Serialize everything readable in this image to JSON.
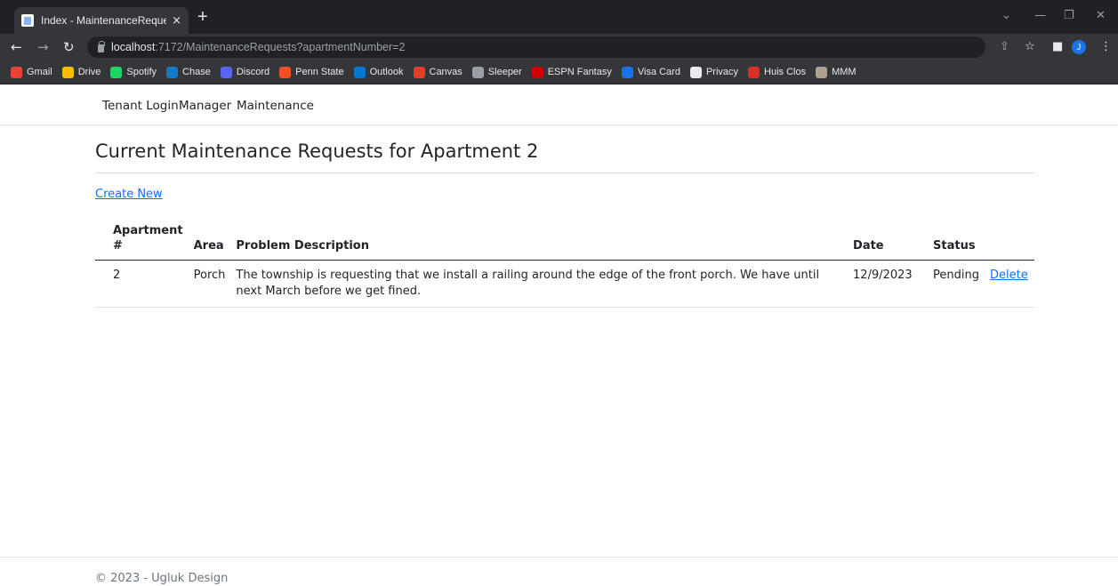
{
  "browser": {
    "tab_title": "Index - MaintenanceRequestApp",
    "tab_close": "×",
    "new_tab": "+",
    "url_host": "localhost",
    "url_rest": ":7172/MaintenanceRequests?apartmentNumber=2",
    "profile_initial": "J",
    "bookmarks": [
      {
        "label": "Gmail",
        "icon": "gmail-icon",
        "color": "#ea4335"
      },
      {
        "label": "Drive",
        "icon": "drive-icon",
        "color": "#fbbc04"
      },
      {
        "label": "Spotify",
        "icon": "spotify-icon",
        "color": "#1ed760"
      },
      {
        "label": "Chase",
        "icon": "chase-icon",
        "color": "#117aca"
      },
      {
        "label": "Discord",
        "icon": "discord-icon",
        "color": "#5865f2"
      },
      {
        "label": "Penn State",
        "icon": "windows-icon",
        "color": "#f25022"
      },
      {
        "label": "Outlook",
        "icon": "outlook-icon",
        "color": "#0078d4"
      },
      {
        "label": "Canvas",
        "icon": "canvas-icon",
        "color": "#e13f2b"
      },
      {
        "label": "Sleeper",
        "icon": "sleeper-icon",
        "color": "#9aa0a6"
      },
      {
        "label": "ESPN Fantasy",
        "icon": "espn-icon",
        "color": "#d00000"
      },
      {
        "label": "Visa Card",
        "icon": "visa-icon",
        "color": "#1a73e8"
      },
      {
        "label": "Privacy",
        "icon": "privacy-icon",
        "color": "#e8eaed"
      },
      {
        "label": "Huis Clos",
        "icon": "huis-clos-icon",
        "color": "#d93025"
      },
      {
        "label": "MMM",
        "icon": "mmm-icon",
        "color": "#b0a090"
      }
    ]
  },
  "nav": {
    "tenant_login": "Tenant Login",
    "manager": "Manager",
    "maintenance": "Maintenance"
  },
  "main": {
    "heading": "Current Maintenance Requests for Apartment 2",
    "create_new": "Create New",
    "columns": {
      "apartment": "Apartment #",
      "area": "Area",
      "problem": "Problem Description",
      "date": "Date",
      "status": "Status"
    },
    "rows": [
      {
        "apartment": "2",
        "area": "Porch",
        "problem": "The township is requesting that we install a railing around the edge of the front porch. We have until next March before we get fined.",
        "date": "12/9/2023",
        "status": "Pending",
        "action": "Delete"
      }
    ]
  },
  "footer": {
    "text": "© 2023 - Ugluk Design"
  }
}
